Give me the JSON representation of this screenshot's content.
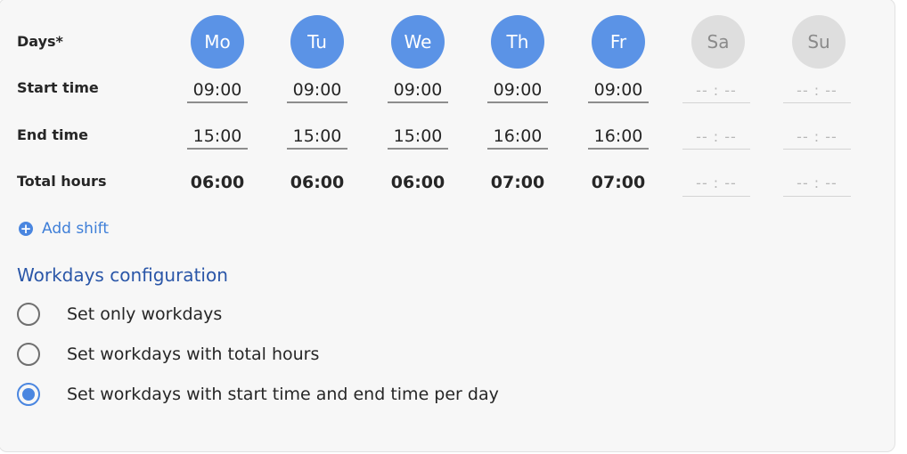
{
  "labels": {
    "days": "Days*",
    "start_time": "Start time",
    "end_time": "End time",
    "total_hours": "Total hours"
  },
  "days": [
    {
      "abbr": "Mo",
      "active": true,
      "start": "09:00",
      "end": "15:00",
      "total": "06:00"
    },
    {
      "abbr": "Tu",
      "active": true,
      "start": "09:00",
      "end": "15:00",
      "total": "06:00"
    },
    {
      "abbr": "We",
      "active": true,
      "start": "09:00",
      "end": "15:00",
      "total": "06:00"
    },
    {
      "abbr": "Th",
      "active": true,
      "start": "09:00",
      "end": "16:00",
      "total": "07:00"
    },
    {
      "abbr": "Fr",
      "active": true,
      "start": "09:00",
      "end": "16:00",
      "total": "07:00"
    },
    {
      "abbr": "Sa",
      "active": false,
      "start": "-- : --",
      "end": "-- : --",
      "total": "-- : --"
    },
    {
      "abbr": "Su",
      "active": false,
      "start": "-- : --",
      "end": "-- : --",
      "total": "-- : --"
    }
  ],
  "add_shift": {
    "icon": "plus-circle-icon",
    "label": "Add shift"
  },
  "workdays_config": {
    "title": "Workdays configuration",
    "options": [
      {
        "label": "Set only workdays",
        "checked": false
      },
      {
        "label": "Set workdays with total hours",
        "checked": false
      },
      {
        "label": "Set workdays with start time and end time per day",
        "checked": true
      }
    ]
  },
  "colors": {
    "accent": "#5b93e6",
    "inactive_day": "#dedede",
    "section_title": "#2a56a8",
    "link": "#3f7fd8"
  }
}
